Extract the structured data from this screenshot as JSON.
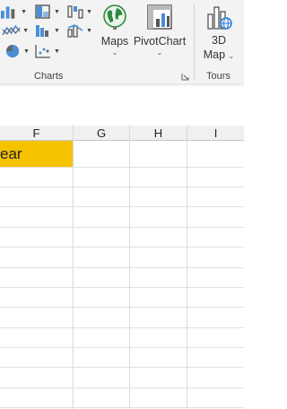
{
  "ribbon": {
    "buttons": {
      "maps_label": "Maps",
      "pivotchart_label": "PivotChart",
      "map3d_line1": "3D",
      "map3d_line2": "Map"
    },
    "groups": {
      "charts_label": "Charts",
      "tours_label": "Tours"
    },
    "icons": [
      "bar-chart-icon",
      "hierarchy-chart-icon",
      "waterfall-chart-icon",
      "line-chart-icon",
      "statistic-chart-icon",
      "combo-chart-icon",
      "pie-chart-icon",
      "scatter-chart-icon",
      "maps-globe-icon",
      "pivotchart-icon",
      "3d-map-icon"
    ]
  },
  "sheet": {
    "columns": [
      "F",
      "G",
      "H",
      "I"
    ],
    "cell_partial_text": "ear",
    "highlight_color": "#f5c200"
  }
}
